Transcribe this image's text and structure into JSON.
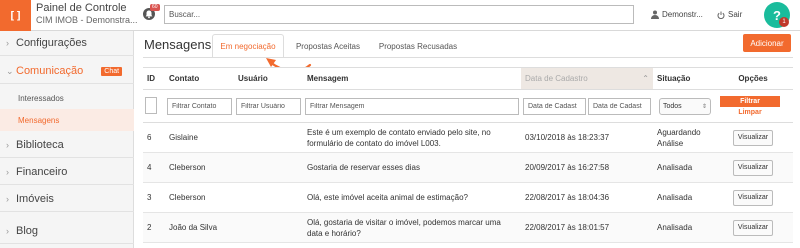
{
  "brand": {
    "logo_glyph": "[]",
    "title": "Painel de Controle",
    "subtitle": "CIM IMOB - Demonstra..."
  },
  "notifications": {
    "badge": "60"
  },
  "search": {
    "placeholder": "Buscar..."
  },
  "user": {
    "name": "Demonstr..."
  },
  "logout": {
    "label": "Sair"
  },
  "help": {
    "label": "?",
    "badge": "1"
  },
  "sidebar": {
    "items": [
      {
        "label": "Configurações"
      },
      {
        "label": "Comunicação",
        "badge": "Chat"
      },
      {
        "label": "Biblioteca"
      },
      {
        "label": "Financeiro"
      },
      {
        "label": "Imóveis"
      },
      {
        "label": "Blog"
      }
    ],
    "subitems": [
      {
        "label": "Interessados"
      },
      {
        "label": "Mensagens"
      }
    ]
  },
  "main": {
    "title": "Mensagens",
    "tabs": [
      {
        "label": "Em negociação"
      },
      {
        "label": "Propostas Aceitas"
      },
      {
        "label": "Propostas Recusadas"
      }
    ],
    "add_button": "Adicionar",
    "columns": [
      "ID",
      "Contato",
      "Usuário",
      "Mensagem",
      "Data de Cadastro",
      "Situação",
      "Opções"
    ],
    "filters": {
      "contato_placeholder": "Filtrar Contato",
      "usuario_placeholder": "Filtrar Usuário",
      "mensagem_placeholder": "Filtrar Mensagem",
      "date_from_placeholder": "Data de Cadast",
      "date_to_placeholder": "Data de Cadast",
      "situacao_selected": "Todos",
      "filter_button": "Filtrar",
      "clear_link": "Limpar"
    },
    "rows": [
      {
        "id": "6",
        "contato": "Gislaine",
        "usuario": "",
        "mensagem": "Este é um exemplo de contato enviado pelo site, no formulário de contato do imóvel L003.",
        "data": "03/10/2018 às 18:23:37",
        "situacao": "Aguardando Análise",
        "acao": "Visualizar"
      },
      {
        "id": "4",
        "contato": "Cleberson",
        "usuario": "",
        "mensagem": "Gostaria de reservar esses dias",
        "data": "20/09/2017 às 16:27:58",
        "situacao": "Analisada",
        "acao": "Visualizar"
      },
      {
        "id": "3",
        "contato": "Cleberson",
        "usuario": "",
        "mensagem": "Olá, este imóvel aceita animal de estimação?",
        "data": "22/08/2017 às 18:04:36",
        "situacao": "Analisada",
        "acao": "Visualizar"
      },
      {
        "id": "2",
        "contato": "João da Silva",
        "usuario": "",
        "mensagem": "Olá, gostaria de visitar o imóvel, podemos marcar uma data e horário?",
        "data": "22/08/2017 às 18:01:57",
        "situacao": "Analisada",
        "acao": "Visualizar"
      }
    ]
  },
  "colors": {
    "accent": "#f26a2e",
    "help": "#1abc9c",
    "badge": "#d9534f"
  }
}
